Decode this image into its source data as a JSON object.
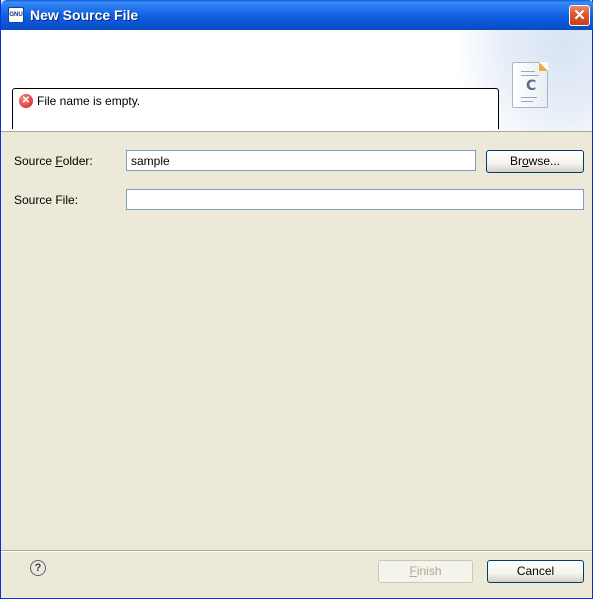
{
  "window": {
    "title": "New Source File",
    "app_icon_label": "GNU",
    "close_glyph": "✕"
  },
  "banner": {
    "message": "File name is empty.",
    "message_icon": "error-icon",
    "wizard_icon": "c-source-file-icon",
    "wizard_icon_letter": "C"
  },
  "form": {
    "source_folder_label_prefix": "Source ",
    "source_folder_label_mnemonic": "F",
    "source_folder_label_suffix": "older:",
    "source_folder_value": "sample",
    "browse_prefix": "Br",
    "browse_mnemonic": "o",
    "browse_suffix": "wse...",
    "source_file_label": "Source File:",
    "source_file_value": ""
  },
  "footer": {
    "help_glyph": "?",
    "finish_mnemonic": "F",
    "finish_suffix": "inish",
    "finish_enabled": false,
    "cancel_label": "Cancel"
  },
  "colors": {
    "titlebar": "#0b54d3",
    "dialog_background": "#ece9d8",
    "error": "#d11a1a"
  }
}
